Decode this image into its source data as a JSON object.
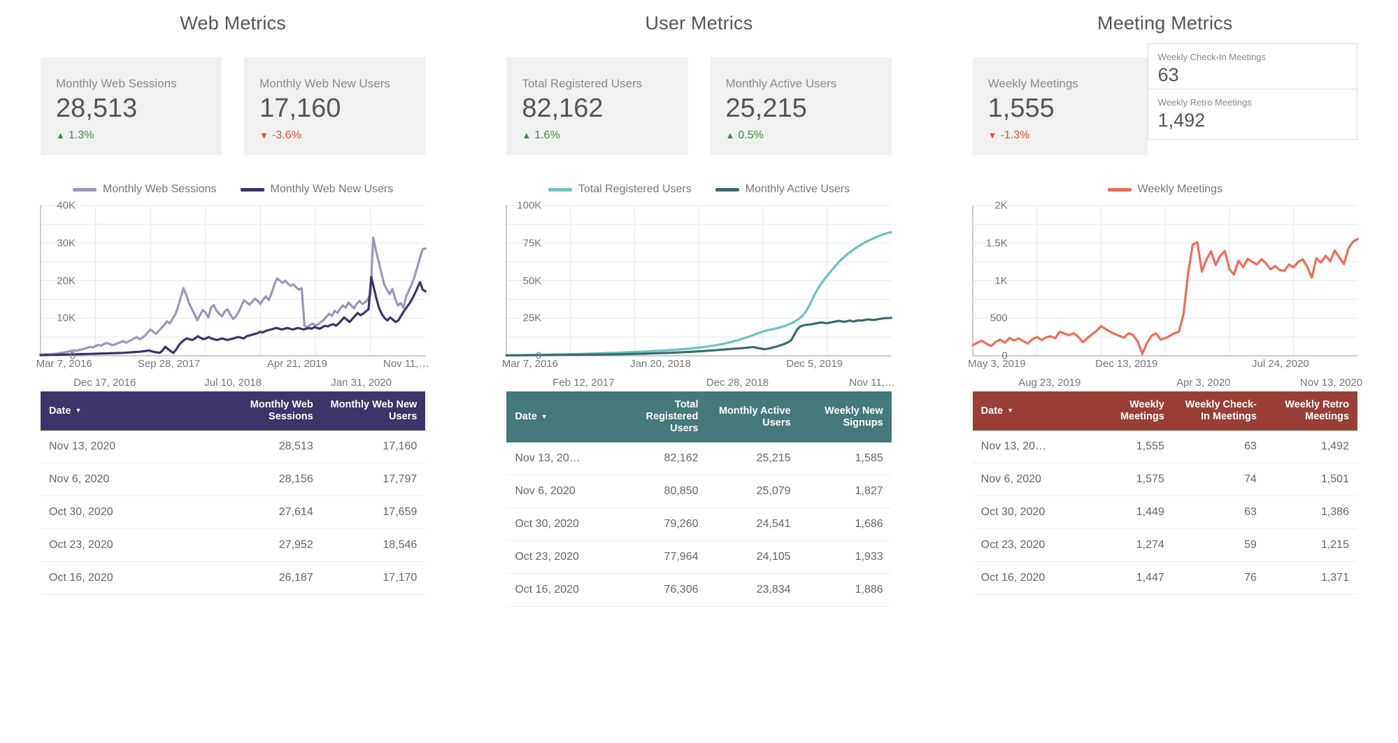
{
  "panels": [
    {
      "title": "Web Metrics",
      "scorecards": [
        {
          "label": "Monthly Web Sessions",
          "value": "28,513",
          "delta": "1.3%",
          "direction": "up",
          "arrow": "arrow-up-icon"
        },
        {
          "label": "Monthly Web New Users",
          "value": "17,160",
          "delta": "-3.6%",
          "direction": "down",
          "arrow": "arrow-down-icon"
        }
      ],
      "mini_scorecards": [],
      "table": {
        "header_color": "#3d3469",
        "columns": [
          "Date",
          "Monthly Web Sessions",
          "Monthly Web New Users"
        ],
        "sort_column": "Date",
        "sort_caret": "▼",
        "rows": [
          [
            "Nov 13, 2020",
            "28,513",
            "17,160"
          ],
          [
            "Nov 6, 2020",
            "28,156",
            "17,797"
          ],
          [
            "Oct 30, 2020",
            "27,614",
            "17,659"
          ],
          [
            "Oct 23, 2020",
            "27,952",
            "18,546"
          ],
          [
            "Oct 16, 2020",
            "26,187",
            "17,170"
          ]
        ]
      }
    },
    {
      "title": "User Metrics",
      "scorecards": [
        {
          "label": "Total Registered Users",
          "value": "82,162",
          "delta": "1.6%",
          "direction": "up",
          "arrow": "arrow-up-icon"
        },
        {
          "label": "Monthly Active Users",
          "value": "25,215",
          "delta": "0.5%",
          "direction": "up",
          "arrow": "arrow-up-icon"
        }
      ],
      "mini_scorecards": [],
      "table": {
        "header_color": "#46797a",
        "columns": [
          "Date",
          "Total Registered Users",
          "Monthly Active Users",
          "Weekly New Signups"
        ],
        "sort_column": "Date",
        "sort_caret": "▼",
        "rows": [
          [
            "Nov 13, 20…",
            "82,162",
            "25,215",
            "1,585"
          ],
          [
            "Nov 6, 2020",
            "80,850",
            "25,079",
            "1,827"
          ],
          [
            "Oct 30, 2020",
            "79,260",
            "24,541",
            "1,686"
          ],
          [
            "Oct 23, 2020",
            "77,964",
            "24,105",
            "1,933"
          ],
          [
            "Oct 16, 2020",
            "76,306",
            "23,834",
            "1,886"
          ]
        ]
      }
    },
    {
      "title": "Meeting Metrics",
      "scorecards": [
        {
          "label": "Weekly Meetings",
          "value": "1,555",
          "delta": "-1.3%",
          "direction": "down",
          "arrow": "arrow-down-icon"
        }
      ],
      "mini_scorecards": [
        {
          "label": "Weekly Check-In Meetings",
          "value": "63"
        },
        {
          "label": "Weekly Retro Meetings",
          "value": "1,492"
        }
      ],
      "table": {
        "header_color": "#993f38",
        "columns": [
          "Date",
          "Weekly Meetings",
          "Weekly Check-In Meetings",
          "Weekly Retro Meetings"
        ],
        "sort_column": "Date",
        "sort_caret": "▼",
        "rows": [
          [
            "Nov 13, 20…",
            "1,555",
            "63",
            "1,492"
          ],
          [
            "Nov 6, 2020",
            "1,575",
            "74",
            "1,501"
          ],
          [
            "Oct 30, 2020",
            "1,449",
            "63",
            "1,386"
          ],
          [
            "Oct 23, 2020",
            "1,274",
            "59",
            "1,215"
          ],
          [
            "Oct 16, 2020",
            "1,447",
            "76",
            "1,371"
          ]
        ]
      }
    }
  ],
  "chart_data": [
    {
      "type": "line",
      "title": "Web Metrics",
      "xlabel": "",
      "ylabel": "",
      "ylim": [
        0,
        40000
      ],
      "yticks": [
        0,
        10000,
        20000,
        30000,
        40000
      ],
      "ytick_labels": [
        "0",
        "10K",
        "20K",
        "30K",
        "40K"
      ],
      "grid": true,
      "legend_position": "top-center",
      "xtick_labels_row1": [
        "Mar 7, 2016",
        "Sep 28, 2017",
        "Apr 21, 2019",
        "Nov 11,…"
      ],
      "xtick_labels_row2": [
        "Dec 17, 2016",
        "Jul 10, 2018",
        "Jan 31, 2020"
      ],
      "series": [
        {
          "name": "Monthly Web Sessions",
          "color": "#9e95b8",
          "values": [
            300,
            350,
            420,
            380,
            450,
            520,
            600,
            700,
            820,
            950,
            1100,
            1250,
            1400,
            1300,
            1500,
            1700,
            1900,
            2100,
            2400,
            2200,
            2600,
            2900,
            2700,
            3100,
            3400,
            3200,
            2800,
            3000,
            3300,
            3600,
            3900,
            3500,
            3800,
            4200,
            4600,
            5000,
            4400,
            4800,
            5400,
            6200,
            7000,
            6400,
            5800,
            6600,
            7400,
            8200,
            9200,
            8600,
            9800,
            11000,
            13000,
            15500,
            18000,
            16200,
            14000,
            12500,
            11000,
            9500,
            10800,
            12200,
            11500,
            10200,
            12800,
            13500,
            12000,
            11200,
            10500,
            11800,
            12400,
            11000,
            9800,
            10400,
            11600,
            13200,
            14800,
            14200,
            13600,
            14400,
            15200,
            14600,
            13800,
            15000,
            15800,
            14800,
            16600,
            18800,
            20600,
            20000,
            19400,
            20000,
            19200,
            18600,
            19000,
            18200,
            17600,
            18000,
            8000,
            7600,
            8200,
            8600,
            8000,
            8400,
            9000,
            9600,
            10400,
            11200,
            10600,
            12000,
            11400,
            12600,
            13400,
            12800,
            14200,
            13400,
            12600,
            13800,
            14600,
            13800,
            14200,
            15000,
            16200,
            31500,
            28000,
            25000,
            22000,
            19000,
            17600,
            16400,
            17800,
            15200,
            13400,
            14000,
            12800,
            15800,
            17400,
            19000,
            21000,
            23500,
            26000,
            28400,
            28513
          ],
          "last_value": 28513
        },
        {
          "name": "Monthly Web New Users",
          "color": "#3d3469",
          "values": [
            150,
            170,
            180,
            200,
            220,
            240,
            260,
            280,
            300,
            320,
            340,
            360,
            380,
            400,
            420,
            440,
            460,
            480,
            500,
            520,
            540,
            560,
            580,
            600,
            620,
            650,
            680,
            700,
            720,
            750,
            780,
            800,
            850,
            900,
            950,
            1000,
            1050,
            1100,
            1200,
            1300,
            1400,
            1200,
            1000,
            900,
            800,
            1400,
            2400,
            1800,
            1200,
            800,
            1600,
            2800,
            3600,
            4200,
            4600,
            4400,
            4200,
            4600,
            5200,
            4800,
            4400,
            4600,
            5000,
            4600,
            4400,
            4200,
            4400,
            4600,
            4400,
            4200,
            4400,
            4600,
            4800,
            5000,
            4800,
            4600,
            5200,
            5400,
            5600,
            5800,
            6000,
            6400,
            6200,
            6600,
            6800,
            7000,
            7200,
            7400,
            7200,
            7000,
            7200,
            7400,
            7200,
            7000,
            7200,
            7400,
            7200,
            7000,
            7200,
            7400,
            7200,
            7600,
            7400,
            7200,
            7600,
            8000,
            7800,
            8200,
            8400,
            8000,
            8600,
            9400,
            10200,
            9600,
            9000,
            9800,
            10600,
            11400,
            10800,
            11200,
            11800,
            12400,
            21000,
            18000,
            15000,
            12500,
            11000,
            10000,
            9400,
            10200,
            9600,
            9000,
            9400,
            10600,
            11800,
            12800,
            13800,
            15000,
            16400,
            18000,
            19600,
            17600,
            17160
          ],
          "last_value": 17160
        }
      ]
    },
    {
      "type": "line",
      "title": "User Metrics",
      "xlabel": "",
      "ylabel": "",
      "ylim": [
        0,
        100000
      ],
      "yticks": [
        0,
        25000,
        50000,
        75000,
        100000
      ],
      "ytick_labels": [
        "0",
        "25K",
        "50K",
        "75K",
        "100K"
      ],
      "grid": true,
      "legend_position": "top-center",
      "xtick_labels_row1": [
        "Mar 7, 2016",
        "Jan 20, 2018",
        "Dec 5, 2019"
      ],
      "xtick_labels_row2": [
        "Feb 12, 2017",
        "Dec 28, 2018",
        "Nov 11,…"
      ],
      "series": [
        {
          "name": "Total Registered Users",
          "color": "#6fc0c0",
          "values": [
            300,
            330,
            360,
            390,
            420,
            450,
            480,
            510,
            540,
            570,
            600,
            640,
            680,
            720,
            760,
            800,
            840,
            880,
            920,
            960,
            1000,
            1050,
            1100,
            1150,
            1200,
            1250,
            1300,
            1360,
            1420,
            1480,
            1540,
            1600,
            1660,
            1720,
            1790,
            1860,
            1930,
            2000,
            2070,
            2150,
            2230,
            2310,
            2390,
            2470,
            2560,
            2650,
            2740,
            2830,
            2930,
            3030,
            3130,
            3240,
            3350,
            3460,
            3580,
            3700,
            3830,
            3960,
            4100,
            4250,
            4400,
            4560,
            4720,
            4900,
            5100,
            5300,
            5520,
            5750,
            6000,
            6280,
            6580,
            6900,
            7250,
            7620,
            8020,
            8450,
            8900,
            9400,
            9950,
            10500,
            11100,
            11750,
            12400,
            13100,
            13800,
            14500,
            15200,
            15900,
            16500,
            17000,
            17400,
            17800,
            18300,
            18800,
            19400,
            20000,
            20800,
            21600,
            22600,
            23800,
            25200,
            27000,
            29500,
            33000,
            37000,
            41000,
            44500,
            47500,
            50200,
            52800,
            55200,
            57500,
            59800,
            62000,
            64000,
            65800,
            67500,
            69000,
            70400,
            71800,
            73000,
            74200,
            75300,
            76300,
            77300,
            78200,
            79000,
            79800,
            80500,
            81200,
            81800,
            82162
          ],
          "last_value": 82162
        },
        {
          "name": "Monthly Active Users",
          "color": "#3d6b6e",
          "values": [
            250,
            270,
            290,
            300,
            320,
            330,
            350,
            360,
            380,
            390,
            410,
            420,
            440,
            450,
            470,
            480,
            500,
            510,
            530,
            540,
            560,
            580,
            600,
            620,
            640,
            660,
            680,
            700,
            720,
            740,
            770,
            800,
            830,
            860,
            890,
            920,
            950,
            980,
            1010,
            1050,
            1090,
            1130,
            1170,
            1210,
            1260,
            1310,
            1360,
            1410,
            1470,
            1530,
            1590,
            1650,
            1720,
            1790,
            1860,
            1930,
            2010,
            2090,
            2180,
            2270,
            2360,
            2460,
            2560,
            2670,
            2780,
            2900,
            3020,
            3150,
            3280,
            3420,
            3560,
            3700,
            3850,
            4000,
            4150,
            4300,
            4450,
            4600,
            4750,
            4900,
            5050,
            5200,
            5400,
            5600,
            5800,
            5400,
            5000,
            4600,
            4400,
            4700,
            5100,
            5600,
            6200,
            6800,
            7400,
            8200,
            9000,
            10500,
            14000,
            17500,
            19500,
            20200,
            20600,
            20800,
            21000,
            21400,
            21800,
            22200,
            22000,
            21600,
            22000,
            22400,
            22800,
            23200,
            23000,
            22600,
            23000,
            23400,
            22800,
            23200,
            23600,
            23400,
            23800,
            24200,
            24000,
            23800,
            24100,
            24500,
            24800,
            25100,
            25079,
            25215
          ],
          "last_value": 25215
        }
      ]
    },
    {
      "type": "line",
      "title": "Meeting Metrics",
      "xlabel": "",
      "ylabel": "",
      "ylim": [
        0,
        2000
      ],
      "yticks": [
        0,
        500,
        1000,
        1500,
        2000
      ],
      "ytick_labels": [
        "0",
        "500",
        "1K",
        "1.5K",
        "2K"
      ],
      "grid": true,
      "legend_position": "top-center",
      "xtick_labels_row1": [
        "May 3, 2019",
        "Dec 13, 2019",
        "Jul 24, 2020"
      ],
      "xtick_labels_row2": [
        "Aug 23, 2019",
        "Apr 3, 2020",
        "Nov 13, 2020"
      ],
      "series": [
        {
          "name": "Weekly Meetings",
          "color": "#ef6c5a",
          "values": [
            140,
            175,
            200,
            160,
            130,
            185,
            215,
            175,
            235,
            205,
            230,
            195,
            165,
            220,
            250,
            210,
            245,
            260,
            235,
            320,
            295,
            275,
            300,
            255,
            180,
            235,
            285,
            330,
            395,
            355,
            320,
            290,
            265,
            240,
            300,
            275,
            190,
            25,
            170,
            265,
            300,
            215,
            235,
            265,
            300,
            320,
            560,
            1100,
            1480,
            1510,
            1120,
            1280,
            1390,
            1210,
            1330,
            1395,
            1155,
            1080,
            1265,
            1180,
            1290,
            1250,
            1215,
            1285,
            1230,
            1150,
            1195,
            1140,
            1130,
            1215,
            1175,
            1250,
            1285,
            1185,
            1040,
            1300,
            1240,
            1330,
            1260,
            1400,
            1310,
            1220,
            1430,
            1520,
            1555
          ],
          "last_value": 1555
        }
      ]
    }
  ]
}
